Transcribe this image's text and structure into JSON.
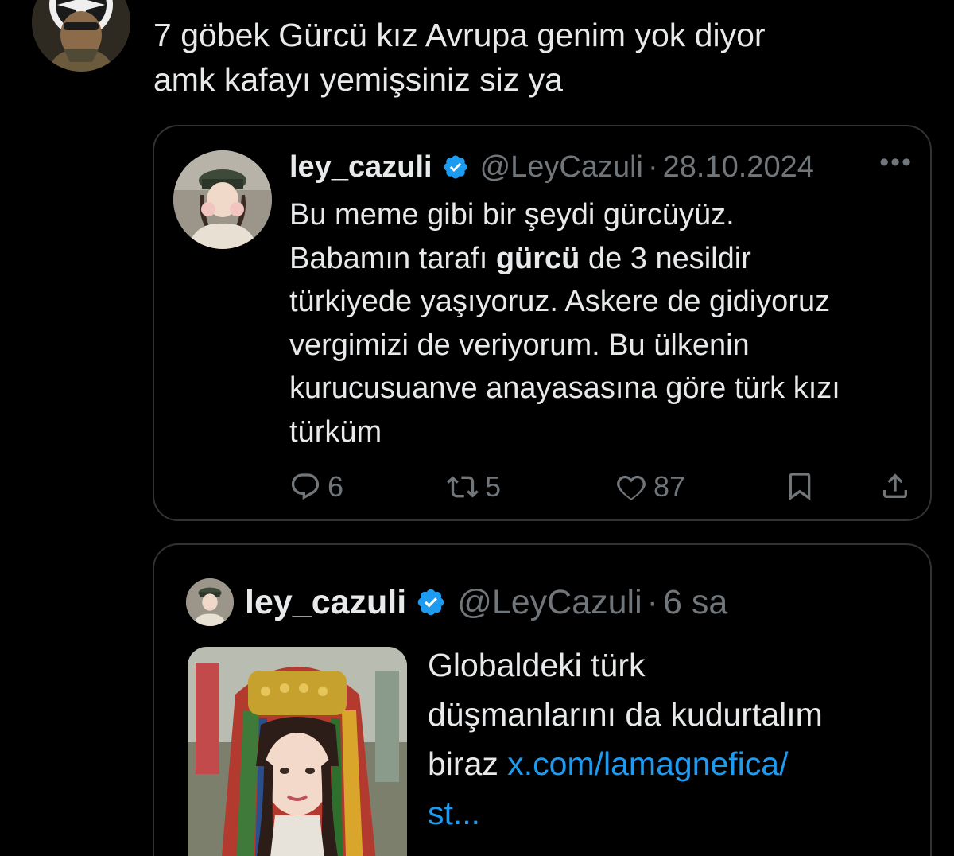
{
  "tweet": {
    "text_lines": [
      "7 göbek Gürcü kız Avrupa genim yok diyor",
      "amk kafayı yemişsiniz siz ya"
    ]
  },
  "quoted": {
    "name": "ley_cazuli",
    "handle": "@LeyCazuli",
    "separator": "·",
    "date": "28.10.2024",
    "more": "•••",
    "body": {
      "line1": "Bu meme gibi bir şeydi gürcüyüz.",
      "line2_a": "Babamın tarafı ",
      "line2_bold": "gürcü",
      "line2_b": " de 3 nesildir",
      "line3": "türkiyede yaşıyoruz. Askere de gidiyoruz",
      "line4": "vergimizi de veriyorum. Bu ülkenin",
      "line5": "kurucusuanve anayasasına göre türk kızı",
      "line6": "türküm"
    },
    "actions": {
      "replies": "6",
      "reposts": "5",
      "likes": "87"
    }
  },
  "second": {
    "name": "ley_cazuli",
    "handle": "@LeyCazuli",
    "separator": "·",
    "time": "6 sa",
    "text": {
      "line1": "Globaldeki türk",
      "line2": "düşmanlarını da kudurtalım",
      "line3_a": "biraz ",
      "line3_link": "x.com/lamagnefica/",
      "line4_link": "st..."
    }
  },
  "colors": {
    "background": "#000000",
    "text": "#e7e9ea",
    "muted": "#71767b",
    "border": "#2f3336",
    "link": "#1d9bf0",
    "verified": "#1d9bf0"
  }
}
